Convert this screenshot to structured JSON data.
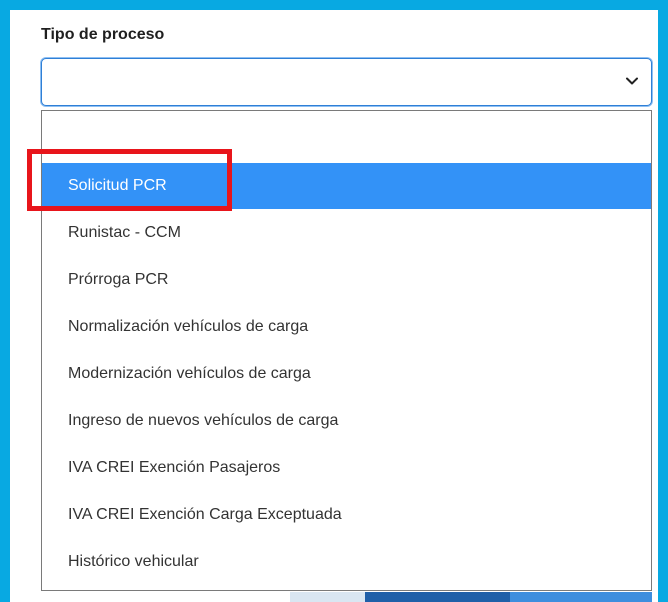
{
  "field": {
    "label": "Tipo de proceso",
    "selected_value": ""
  },
  "dropdown": {
    "options": [
      "",
      "Solicitud PCR",
      "Runistac - CCM",
      "Prórroga PCR",
      "Normalización vehículos de carga",
      "Modernización vehículos de carga",
      "Ingreso de nuevos vehículos de carga",
      "IVA CREI Exención Pasajeros",
      "IVA CREI Exención Carga Exceptuada",
      "Histórico vehicular"
    ],
    "highlighted_index": 1
  },
  "colors": {
    "frame": "#08a9e2",
    "option_highlight": "#3392f7",
    "annotation_box": "#e8151b"
  },
  "icons": {
    "select_toggle": "chevron-down-icon"
  }
}
